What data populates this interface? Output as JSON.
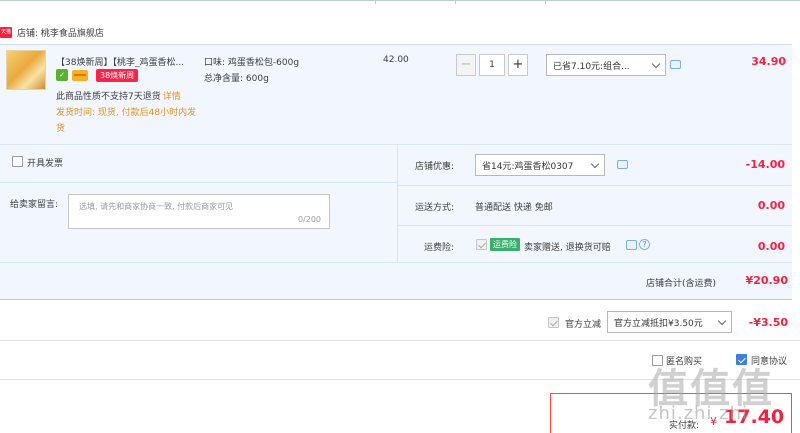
{
  "shop": {
    "badge": "天猫",
    "name": "店铺: 桃李食品旗舰店"
  },
  "item": {
    "title": "【38焕新周】【桃李_鸡蛋香松...",
    "promo_badge": "38焕新周",
    "no_return_text": "此商品性质不支持7天退货",
    "detail_link": "详情",
    "ship_time": "发货时间: 现货, 付款后48小时内发货",
    "attr_flavor": "口味: 鸡蛋香松包-600g",
    "attr_weight": "总净含量: 600g",
    "unit_price": "42.00",
    "qty_minus": "−",
    "quantity": "1",
    "qty_plus": "+",
    "discount_select": "已省7.10元:组合...",
    "subtotal": "34.90"
  },
  "invoice": {
    "label": "开具发票"
  },
  "message": {
    "label": "给卖家留言:",
    "placeholder": "选填, 请先和商家协商一致, 付款后商家可见",
    "counter": "0/200"
  },
  "shop_discount": {
    "label": "店铺优惠:",
    "selected": "省14元:鸡蛋香松0307",
    "value": "-14.00"
  },
  "shipping": {
    "label": "运送方式:",
    "method": "普通配送 快递 免邮",
    "value": "0.00"
  },
  "insurance": {
    "label": "运费险:",
    "tag": "运费险",
    "text": "卖家赠送, 退换货可赔",
    "help": "?",
    "value": "0.00"
  },
  "shop_total": {
    "label": "店铺合计(含运费)",
    "value": "¥20.90"
  },
  "official_discount": {
    "label": "官方立减",
    "selected": "官方立减抵扣¥3.50元",
    "value": "-¥3.50"
  },
  "options": {
    "option1_text": "匿名购买",
    "option2_text": "同意协议"
  },
  "payment": {
    "label": "实付款:",
    "currency": "¥",
    "amount": "17.40"
  },
  "watermark": {
    "logo": "值值值",
    "text": "zhi.zhi.zhi"
  },
  "colors": {
    "price_red": "#ff1f3c",
    "row_bg": "#f2f7ff",
    "ship_orange": "#e8911c",
    "insurance_green": "#35b169"
  }
}
